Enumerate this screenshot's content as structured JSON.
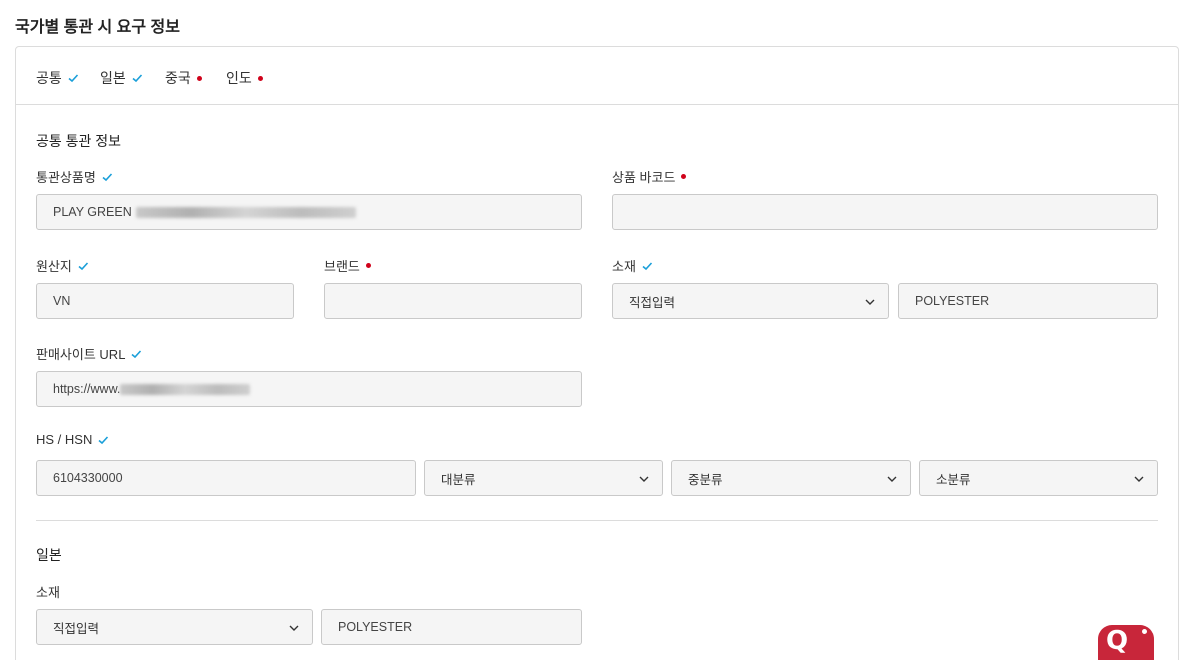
{
  "page_title": "국가별 통관 시 요구 정보",
  "colors": {
    "check": "#1a9fd9",
    "required_dot": "#d0021b",
    "brand": "#c8263a"
  },
  "tabs": [
    {
      "label": "공통",
      "status": "check"
    },
    {
      "label": "일본",
      "status": "check"
    },
    {
      "label": "중국",
      "status": "required"
    },
    {
      "label": "인도",
      "status": "required"
    }
  ],
  "common": {
    "section_title": "공통 통관 정보",
    "product_name": {
      "label": "통관상품명",
      "value": "PLAY GREEN"
    },
    "barcode": {
      "label": "상품 바코드",
      "value": ""
    },
    "origin": {
      "label": "원산지",
      "value": "VN"
    },
    "brand": {
      "label": "브랜드",
      "value": ""
    },
    "material": {
      "label": "소재",
      "select": "직접입력",
      "value": "POLYESTER"
    },
    "site_url": {
      "label": "판매사이트 URL",
      "value": "https://www."
    },
    "hs": {
      "label": "HS / HSN",
      "value": "6104330000",
      "major": "대분류",
      "middle": "중분류",
      "minor": "소분류"
    }
  },
  "japan": {
    "section_title": "일본",
    "material": {
      "label": "소재",
      "select": "직접입력",
      "value": "POLYESTER"
    }
  },
  "logo_text": "Q"
}
